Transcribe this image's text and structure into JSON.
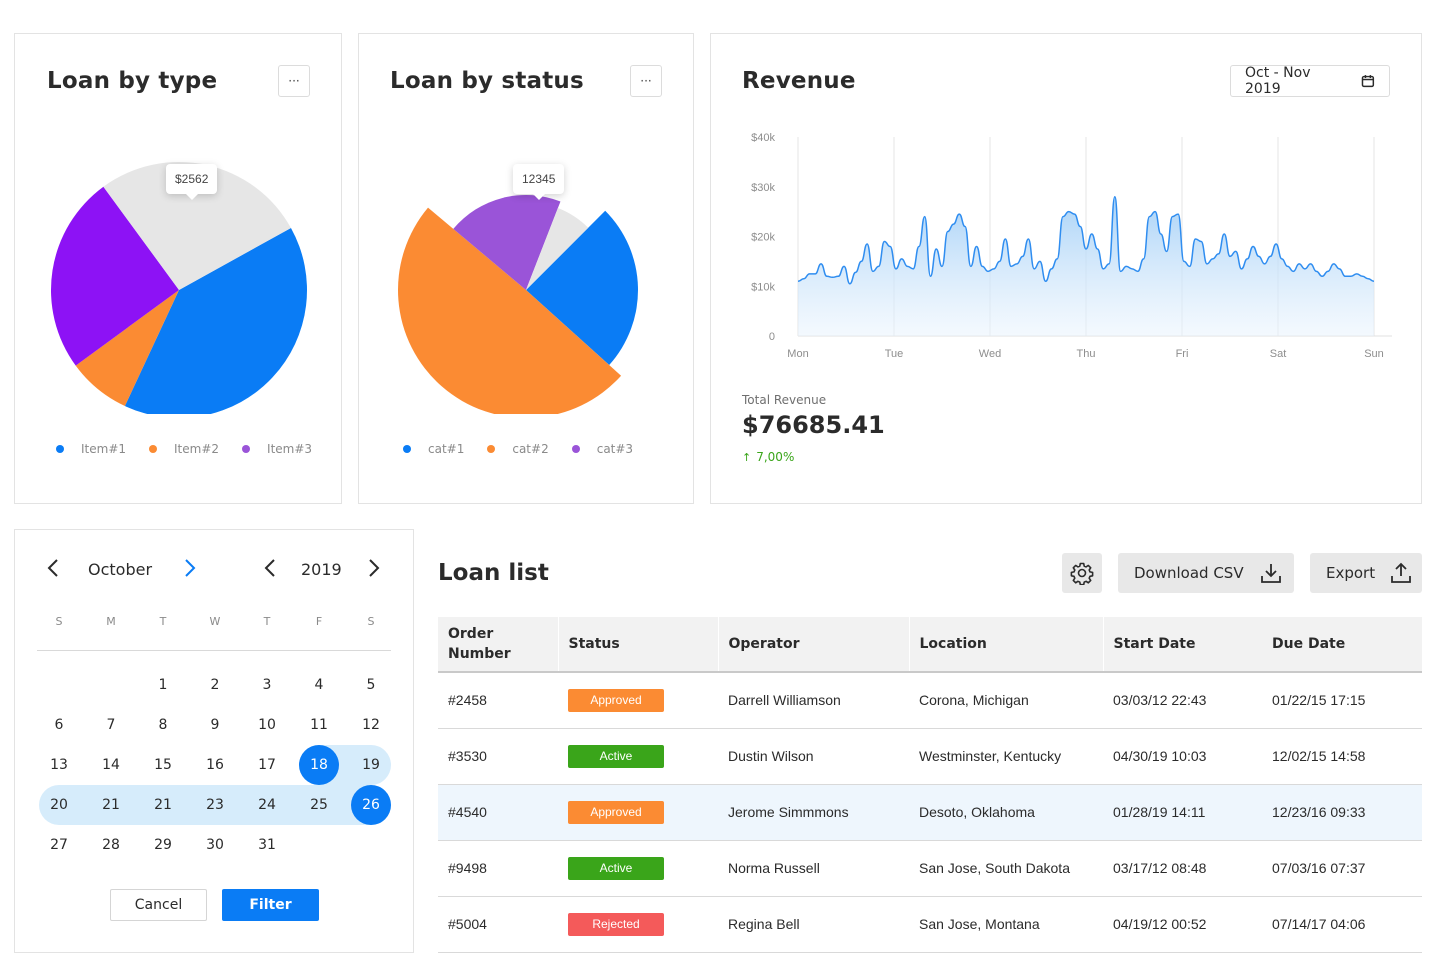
{
  "loan_by_type": {
    "title": "Loan by type",
    "menu_label": "···",
    "tooltip": "$2562",
    "legend": [
      {
        "label": "Item#1",
        "color": "#0a7cf5"
      },
      {
        "label": "Item#2",
        "color": "#fb8b33"
      },
      {
        "label": "Item#3",
        "color": "#9a54d8"
      }
    ]
  },
  "loan_by_status": {
    "title": "Loan by status",
    "menu_label": "···",
    "tooltip": "12345",
    "legend": [
      {
        "label": "cat#1",
        "color": "#0a7cf5"
      },
      {
        "label": "cat#2",
        "color": "#fb8b33"
      },
      {
        "label": "cat#3",
        "color": "#9a54d8"
      }
    ]
  },
  "revenue": {
    "title": "Revenue",
    "date_range": "Oct - Nov 2019",
    "total_label": "Total Revenue",
    "total_value": "$76685.41",
    "change": "7,00%",
    "change_color": "#3aa51a"
  },
  "chart_data": [
    {
      "type": "pie",
      "categories": [
        "Item#1",
        "Item#2",
        "Item#3",
        ""
      ],
      "values": [
        40,
        8,
        25,
        27
      ],
      "colors": [
        "#0a7cf5",
        "#fb8b33",
        "#8d12f5",
        "#e6e6e6"
      ]
    },
    {
      "type": "pie",
      "categories": [
        "cat#1",
        "cat#2",
        "cat#3",
        ""
      ],
      "values": [
        22,
        45,
        18,
        6
      ],
      "colors": [
        "#0a7cf5",
        "#fb8b33",
        "#9a54d8",
        "#e6e6e6"
      ]
    },
    {
      "type": "area",
      "title": "Revenue",
      "x_labels": [
        "Mon",
        "Tue",
        "Wed",
        "Thu",
        "Fri",
        "Sat",
        "Sun"
      ],
      "y_ticks": [
        "$40k",
        "$30k",
        "$20k",
        "$10k",
        "0"
      ],
      "ylim": [
        0,
        40000
      ],
      "grid": true,
      "y": [
        11000,
        11500,
        12500,
        12500,
        14500,
        12000,
        11800,
        12000,
        14000,
        10500,
        12800,
        15000,
        18500,
        13000,
        14000,
        19000,
        18000,
        13500,
        15500,
        14000,
        13500,
        18000,
        24000,
        12000,
        17500,
        14000,
        21000,
        22500,
        24500,
        22000,
        14000,
        18000,
        14000,
        13000,
        13500,
        15000,
        19500,
        14000,
        14500,
        16000,
        19500,
        13500,
        15000,
        11000,
        13500,
        15500,
        24000,
        25000,
        24500,
        22000,
        17500,
        20500,
        17500,
        13500,
        14500,
        28000,
        13000,
        14000,
        13500,
        13000,
        15500,
        24000,
        25000,
        20500,
        17000,
        24000,
        24500,
        15000,
        14000,
        19500,
        19000,
        14500,
        15500,
        16500,
        20500,
        16000,
        17000,
        13500,
        15500,
        18000,
        16000,
        14500,
        16000,
        18500,
        15500,
        14000,
        13000,
        14500,
        13500,
        14500,
        13000,
        12000,
        13000,
        14500,
        13500,
        12000,
        12000,
        12500,
        12000,
        11500,
        11000
      ]
    }
  ],
  "calendar": {
    "month": "October",
    "year": "2019",
    "weekdays": [
      "S",
      "M",
      "T",
      "W",
      "T",
      "F",
      "S"
    ],
    "days": [
      "1",
      "2",
      "3",
      "4",
      "5",
      "6",
      "7",
      "8",
      "9",
      "10",
      "11",
      "12",
      "13",
      "14",
      "15",
      "16",
      "17",
      "18",
      "19",
      "20",
      "21",
      "21",
      "23",
      "24",
      "25",
      "26",
      "27",
      "28",
      "29",
      "30",
      "31"
    ],
    "range_start": "18",
    "range_end": "26",
    "cancel_label": "Cancel",
    "filter_label": "Filter"
  },
  "loan_list": {
    "title": "Loan list",
    "download_label": "Download CSV",
    "export_label": "Export",
    "columns": [
      "Order Number",
      "Status",
      "Operator",
      "Location",
      "Start Date",
      "Due Date"
    ],
    "rows": [
      {
        "order": "#2458",
        "status": "Approved",
        "status_color": "#fb8b33",
        "operator": "Darrell Williamson",
        "location": "Corona, Michigan",
        "start": "03/03/12 22:43",
        "due": "01/22/15 17:15"
      },
      {
        "order": "#3530",
        "status": "Active",
        "status_color": "#3aa51a",
        "operator": "Dustin Wilson",
        "location": "Westminster, Kentucky",
        "start": "04/30/19 10:03",
        "due": "12/02/15 14:58"
      },
      {
        "order": "#4540",
        "status": "Approved",
        "status_color": "#fb8b33",
        "operator": "Jerome Simmmons",
        "location": "Desoto, Oklahoma",
        "start": "01/28/19 14:11",
        "due": "12/23/16 09:33"
      },
      {
        "order": "#9498",
        "status": "Active",
        "status_color": "#3aa51a",
        "operator": "Norma Russell",
        "location": "San Jose, South Dakota",
        "start": "03/17/12 08:48",
        "due": "07/03/16 07:37"
      },
      {
        "order": "#5004",
        "status": "Rejected",
        "status_color": "#f45a5a",
        "operator": "Regina Bell",
        "location": "San Jose, Montana",
        "start": "04/19/12 00:52",
        "due": "07/14/17 04:06"
      }
    ]
  }
}
